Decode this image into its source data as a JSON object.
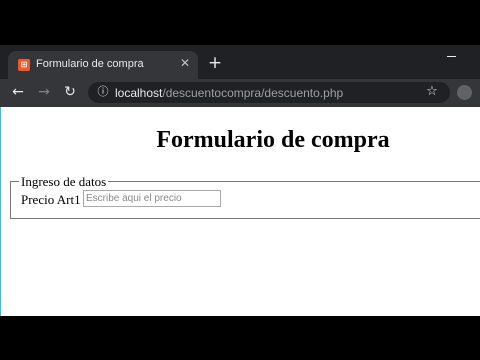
{
  "browser": {
    "tab": {
      "title": "Formulario de compra",
      "favicon_icon": "xampp-icon",
      "favicon_glyph": "⊞",
      "close_glyph": "✕"
    },
    "new_tab_glyph": "+",
    "nav": {
      "back_glyph": "←",
      "forward_glyph": "→",
      "reload_glyph": "↻"
    },
    "address": {
      "lock_glyph": "ⓘ",
      "host": "localhost",
      "path": "/descuentocompra/descuento.php"
    },
    "bookmark_glyph": "☆"
  },
  "page": {
    "heading": "Formulario de compra",
    "fieldset_legend": "Ingreso de datos",
    "price_label": "Precio Art1",
    "price_placeholder": "Escribe aqui el precio",
    "price_value": ""
  },
  "colors": {
    "tab_strip": "#202124",
    "toolbar": "#35363a",
    "page_background": "#ffffff",
    "favicon": "#f1592a"
  }
}
